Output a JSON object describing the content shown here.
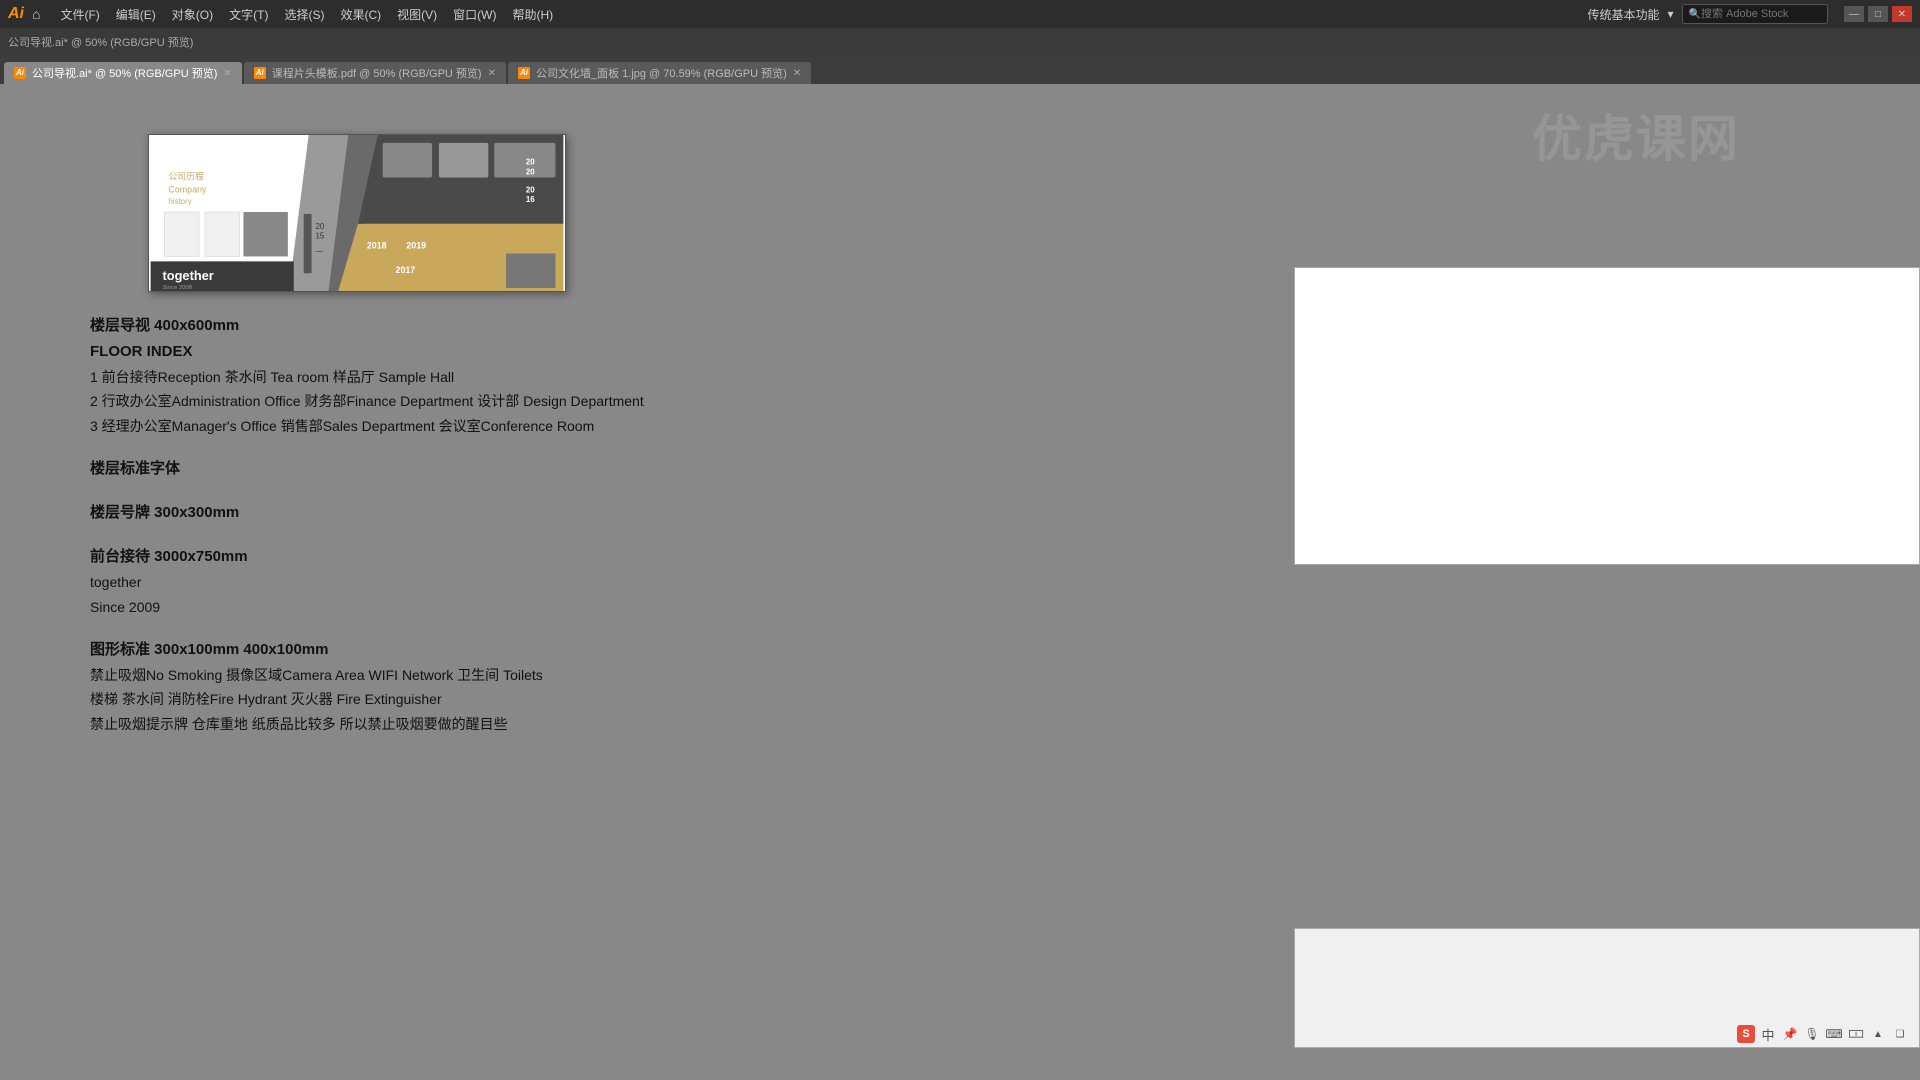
{
  "app": {
    "logo": "Ai",
    "title": "Adobe Illustrator"
  },
  "menubar": {
    "items": [
      "文件(F)",
      "编辑(E)",
      "对象(O)",
      "文字(T)",
      "选择(S)",
      "效果(C)",
      "视图(V)",
      "窗口(W)",
      "帮助(H)"
    ],
    "right_text": "传统基本功能",
    "search_placeholder": "搜索 Adobe Stock"
  },
  "tabs": [
    {
      "id": "tab1",
      "label": "公司导视.ai* @ 50% (RGB/GPU 预览)",
      "active": true
    },
    {
      "id": "tab2",
      "label": "课程片头模板.pdf @ 50% (RGB/GPU 预览)",
      "active": false
    },
    {
      "id": "tab3",
      "label": "公司文化墙_面板 1.jpg @ 70.59% (RGB/GPU 预览)",
      "active": false
    }
  ],
  "document_title": "公司导视.ai* @ 50% (RGB/GPU 预览)",
  "text_content": {
    "line1": "楼层导视 400x600mm",
    "line2": "FLOOR INDEX",
    "line3": "1  前台接待Reception  茶水间 Tea room 样品厅 Sample Hall",
    "line4": "2 行政办公室Administration Office 财务部Finance Department 设计部 Design Department",
    "line5": "3 经理办公室Manager's Office 销售部Sales Department 会议室Conference Room",
    "section2_title": "楼层标准字体",
    "section3_title": "楼层号牌 300x300mm",
    "section4_title": "前台接待 3000x750mm",
    "section4_line1": "together",
    "section4_line2": "Since 2009",
    "section5_title": "图形标准 300x100mm  400x100mm",
    "section5_line1": "禁止吸烟No Smoking 摄像区域Camera Area WIFI Network 卫生间 Toilets",
    "section5_line2": "楼梯 茶水间 消防栓Fire Hydrant 灭火器 Fire Extinguisher",
    "section5_line3": "禁止吸烟提示牌 仓库重地 纸质品比较多 所以禁止吸烟要做的醒目些"
  },
  "watermark": "优虎课网",
  "window_controls": {
    "minimize": "—",
    "maximize": "□",
    "close": "✕"
  }
}
